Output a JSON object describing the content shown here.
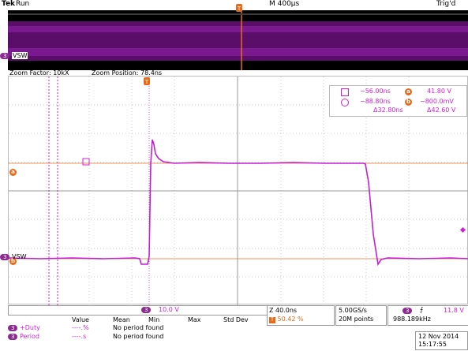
{
  "header": {
    "brand": "Tek",
    "state": "Run",
    "horizontal_scale": "M 400µs",
    "trigger_status": "Trig'd"
  },
  "overview": {
    "channel_label": "VSW",
    "channel_marker": "3"
  },
  "zoom": {
    "factor_text": "Zoom Factor: 10kX",
    "position_text": "Zoom Position: 78.4ns"
  },
  "waveform": {
    "channel_label": "VSW",
    "channel_marker": "3",
    "cursor_a_marker": "a",
    "cursor_b_marker": "b",
    "trigger_marker": "T"
  },
  "cursors": {
    "a_time": "−56.00ns",
    "b_time": "−88.80ns",
    "delta_time": "Δ32.80ns",
    "a_value": "41.80 V",
    "b_value": "−800.0mV",
    "delta_value": "Δ42.60 V",
    "a_marker": "a",
    "b_marker": "b"
  },
  "footer": {
    "channel_scale_marker": "3",
    "channel_scale": "10.0 V",
    "zoom_time_per_div": "Z 40.0ns",
    "zoom_trigger_pos": "50.42 %",
    "zoom_trigger_marker": "T",
    "sample_rate": "5.00GS/s",
    "record_length": "20M points",
    "trigger_channel": "3",
    "trigger_slope": "⨍",
    "trigger_level": "11.8 V",
    "trigger_freq": "988.189kHz",
    "date": "12 Nov 2014",
    "time": "15:17:55"
  },
  "measurements": {
    "columns": [
      "Value",
      "Mean",
      "Min",
      "Max",
      "Std Dev"
    ],
    "rows": [
      {
        "marker": "3",
        "name": "+Duty",
        "value": "----.%",
        "status": "No period found"
      },
      {
        "marker": "3",
        "name": "Period",
        "value": "----.s",
        "status": "No period found"
      }
    ]
  },
  "colors": {
    "trace": "#d21fd8",
    "cursor": "#e76a18",
    "grid": "#c8c8c8"
  }
}
